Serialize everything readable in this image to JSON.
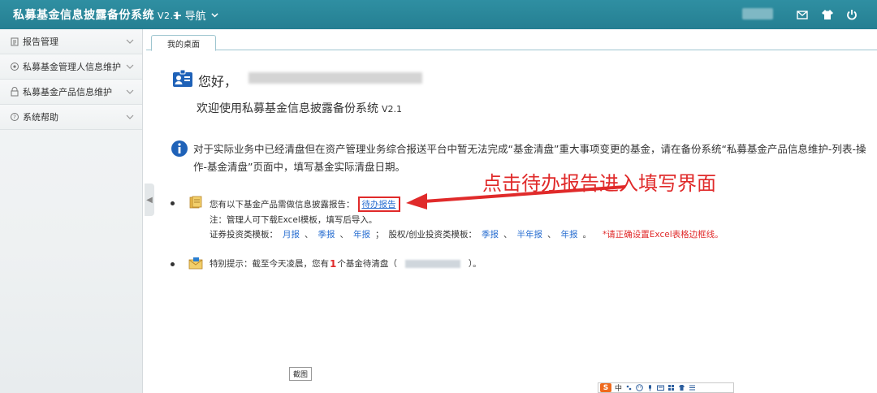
{
  "header": {
    "title": "私募基金信息披露备份系统",
    "version": "V2.1",
    "nav_label": "导航"
  },
  "sidebar": {
    "items": [
      {
        "label": "报告管理",
        "icon": "report-icon"
      },
      {
        "label": "私募基金管理人信息维护",
        "icon": "manager-icon"
      },
      {
        "label": "私募基金产品信息维护",
        "icon": "product-icon"
      },
      {
        "label": "系统帮助",
        "icon": "help-icon"
      }
    ]
  },
  "tabs": [
    {
      "label": "我的桌面"
    }
  ],
  "greeting": {
    "hello": "您好，",
    "welcome": "欢迎使用私募基金信息披露备份系统",
    "version": "V2.1"
  },
  "notice": {
    "text": "对于实际业务中已经清盘但在资产管理业务综合报送平台中暂无法完成“基金清盘”重大事项变更的基金，请在备份系统“私募基金产品信息维护-列表-操作-基金清盘”页面中，填写基金实际清盘日期。"
  },
  "reports": {
    "prefix": "您有以下基金产品需做信息披露报告：",
    "todo_link": "待办报告",
    "note": "注：管理人可下载Excel模板，填写后导入。",
    "securities_label": "证券投资类模板：",
    "securities_links": [
      "月报",
      "季报",
      "年报"
    ],
    "equity_label": "股权/创业投资类模板：",
    "equity_links": [
      "季报",
      "半年报",
      "年报"
    ],
    "separator": "、",
    "sep_end": "；",
    "end": "。",
    "warning": "*请正确设置Excel表格边框线。"
  },
  "special": {
    "prefix": "特别提示：截至今天凌晨，您有",
    "count": "1",
    "middle": "个基金待清盘（",
    "suffix": "）。"
  },
  "annotation": {
    "text": "点击待办报告进入填写界面"
  },
  "tooltip": {
    "text": "截图"
  },
  "ime": {
    "logo": "S",
    "lang": "中"
  },
  "colors": {
    "header": "#2a879a",
    "link": "#2a6fd1",
    "accent_red": "#e02a2a"
  }
}
